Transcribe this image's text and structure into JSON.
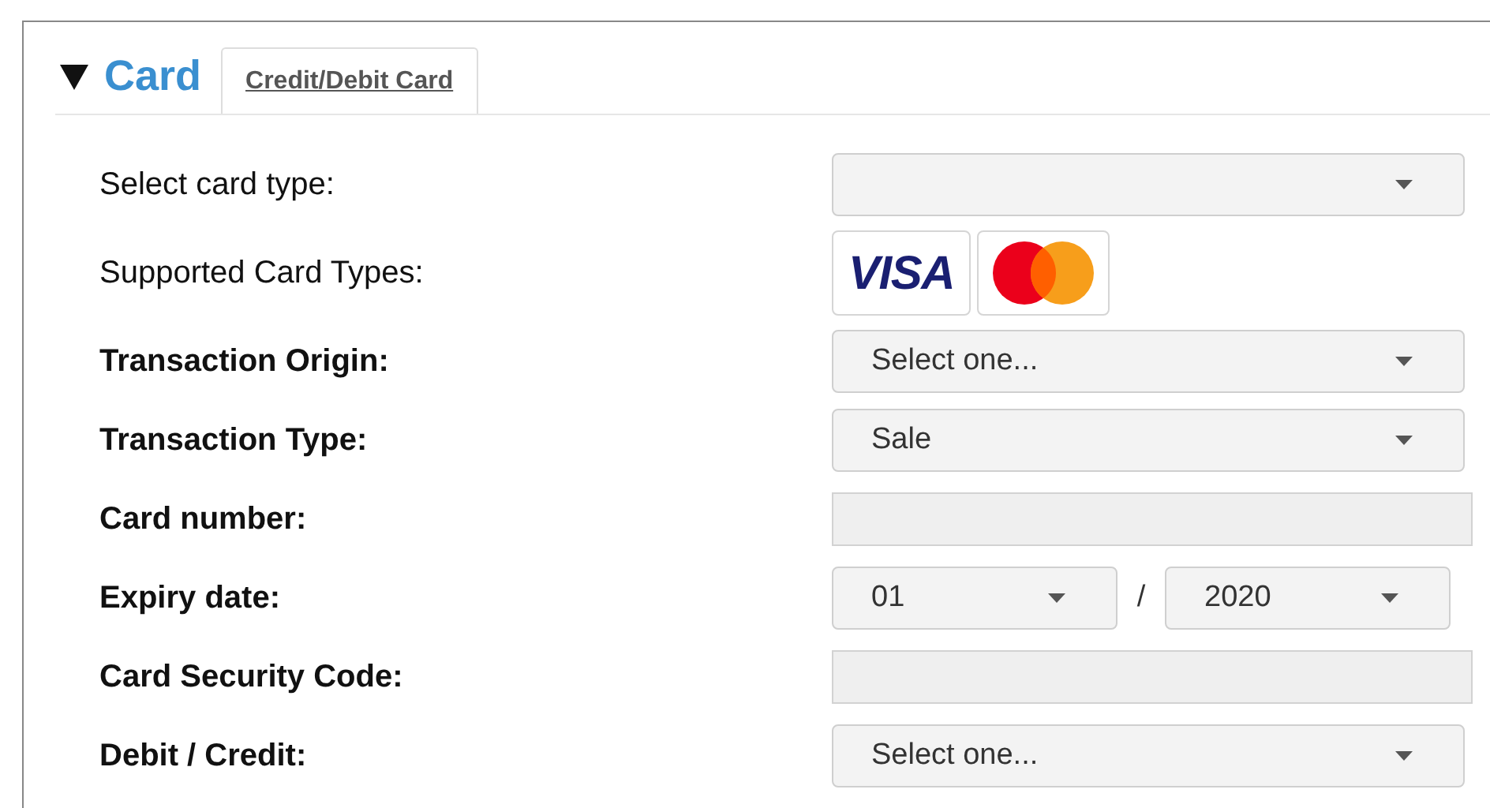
{
  "section": {
    "title": "Card",
    "expanded": true
  },
  "tabs": [
    {
      "label": "Credit/Debit Card",
      "selected": true
    }
  ],
  "fields": [
    {
      "kind": "select",
      "label": "Select card type:",
      "bold": false
    },
    {
      "kind": "cards",
      "label": "Supported Card Types:",
      "bold": false,
      "cards": [
        {
          "kind": "visa",
          "text": "VISA"
        },
        {
          "kind": "mastercard"
        }
      ]
    },
    {
      "kind": "select",
      "label": "Transaction Origin:",
      "bold": true,
      "value": "Select one..."
    },
    {
      "kind": "select",
      "label": "Transaction Type:",
      "bold": true,
      "value": "Sale"
    },
    {
      "kind": "input",
      "label": "Card number:",
      "bold": true
    },
    {
      "kind": "date",
      "label": "Expiry date:",
      "bold": true,
      "month": "01",
      "separator": "/",
      "year": "2020"
    },
    {
      "kind": "input",
      "label": "Card Security Code:",
      "bold": true
    },
    {
      "kind": "select",
      "label": "Debit / Credit:",
      "bold": true,
      "value": "Select one..."
    }
  ]
}
